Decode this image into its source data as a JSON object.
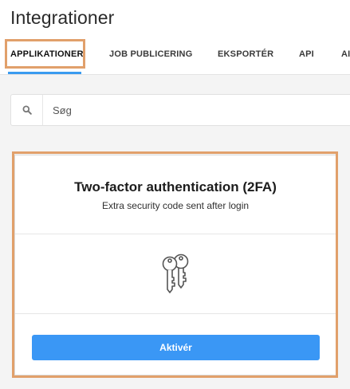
{
  "header": {
    "title": "Integrationer",
    "tabs": [
      {
        "label": "APPLIKATIONER",
        "active": true
      },
      {
        "label": "JOB PUBLICERING"
      },
      {
        "label": "EKSPORTÉR"
      },
      {
        "label": "API"
      },
      {
        "label": "AI"
      }
    ]
  },
  "search": {
    "placeholder": "Søg",
    "value": "",
    "icon": "search-icon"
  },
  "card": {
    "title": "Two-factor authentication (2FA)",
    "subtitle": "Extra security code sent after login",
    "icon": "keys-icon",
    "button_label": "Aktivér"
  },
  "colors": {
    "accent": "#3a97f5",
    "highlight": "#e1a06b"
  }
}
